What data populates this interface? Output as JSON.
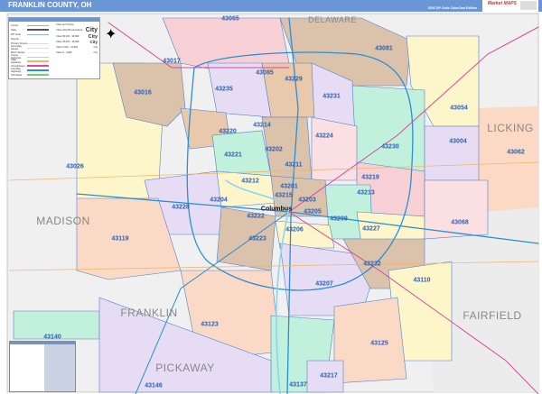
{
  "header": {
    "title": "FRANKLIN COUNTY, OH",
    "edition": "2026 ZIP Code ColorCast Edition",
    "logo": "Market MAPS"
  },
  "legend": {
    "lines": [
      "County",
      "State",
      "ZIP Code",
      "Airports",
      "Primary Streets",
      "Secondary Streets",
      "Minor Streets",
      "County Highways",
      "State Highways",
      "US Highways",
      "Interstate Highways",
      "Toll Roads"
    ],
    "cities_heading": "Cities and Towns",
    "cities": [
      {
        "range": "Cities 100,000 and Above",
        "sample": "City"
      },
      {
        "range": "Cities 50,000 - 99,999",
        "sample": "City"
      },
      {
        "range": "Cities 25,000 - 49,999",
        "sample": "City"
      },
      {
        "range": "Cities 5,000 - 24,999",
        "sample": "City"
      },
      {
        "range": "Cities 0 - 4,999",
        "sample": "City"
      }
    ]
  },
  "counties": [
    "DELAWARE",
    "LICKING",
    "MADISON",
    "FRANKLIN",
    "PICKAWAY",
    "FAIRFIELD"
  ],
  "city": "Columbus",
  "zips": [
    "43065",
    "43081",
    "43017",
    "43085",
    "43229",
    "43016",
    "43235",
    "43231",
    "43054",
    "43004",
    "43062",
    "43220",
    "43214",
    "43224",
    "43230",
    "43202",
    "43221",
    "43211",
    "43026",
    "43212",
    "43219",
    "43201",
    "43213",
    "43215",
    "43204",
    "43228",
    "43203",
    "43205",
    "43209",
    "43227",
    "43222",
    "43068",
    "43206",
    "43223",
    "43119",
    "43232",
    "43110",
    "43207",
    "43123",
    "43125",
    "43140",
    "43217",
    "43137",
    "43146"
  ],
  "colors": {
    "header": "#6a96d6",
    "zip_label": "#2b5fb5",
    "interstate": "#2a8fd6",
    "us_highway": "#e0479a",
    "state_highway": "#f2b56b"
  }
}
